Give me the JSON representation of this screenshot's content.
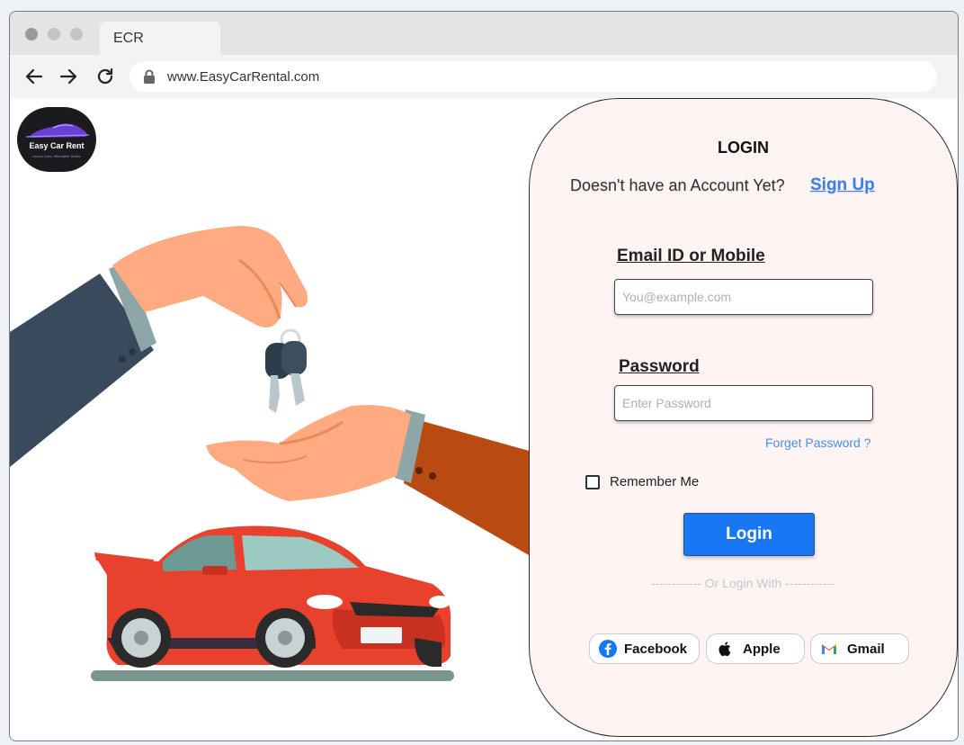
{
  "browser": {
    "tab_title": "ECR",
    "url": "www.EasyCarRental.com"
  },
  "logo": {
    "name": "Easy Car Rent",
    "tagline": "Luxury Cars. Affordable Rates."
  },
  "login": {
    "title": "LOGIN",
    "account_prompt": "Doesn't have an Account Yet?",
    "signup_link": "Sign Up",
    "email_label": "Email ID or Mobile",
    "email_placeholder": "You@example.com",
    "password_label": "Password",
    "password_placeholder": "Enter Password",
    "forgot_link": "Forget Password ?",
    "remember_label": "Remember Me",
    "login_button": "Login",
    "divider_text": "------------ Or Login With ------------",
    "social": {
      "facebook": "Facebook",
      "apple": "Apple",
      "gmail": "Gmail"
    }
  },
  "colors": {
    "panel_bg": "#fef4f4",
    "accent_blue": "#1877f2",
    "link_blue": "#3b82e8",
    "car_red": "#e8412e",
    "sleeve_dark": "#394a5c",
    "sleeve_rust": "#b84a12",
    "hand_skin": "#ffaa80"
  }
}
